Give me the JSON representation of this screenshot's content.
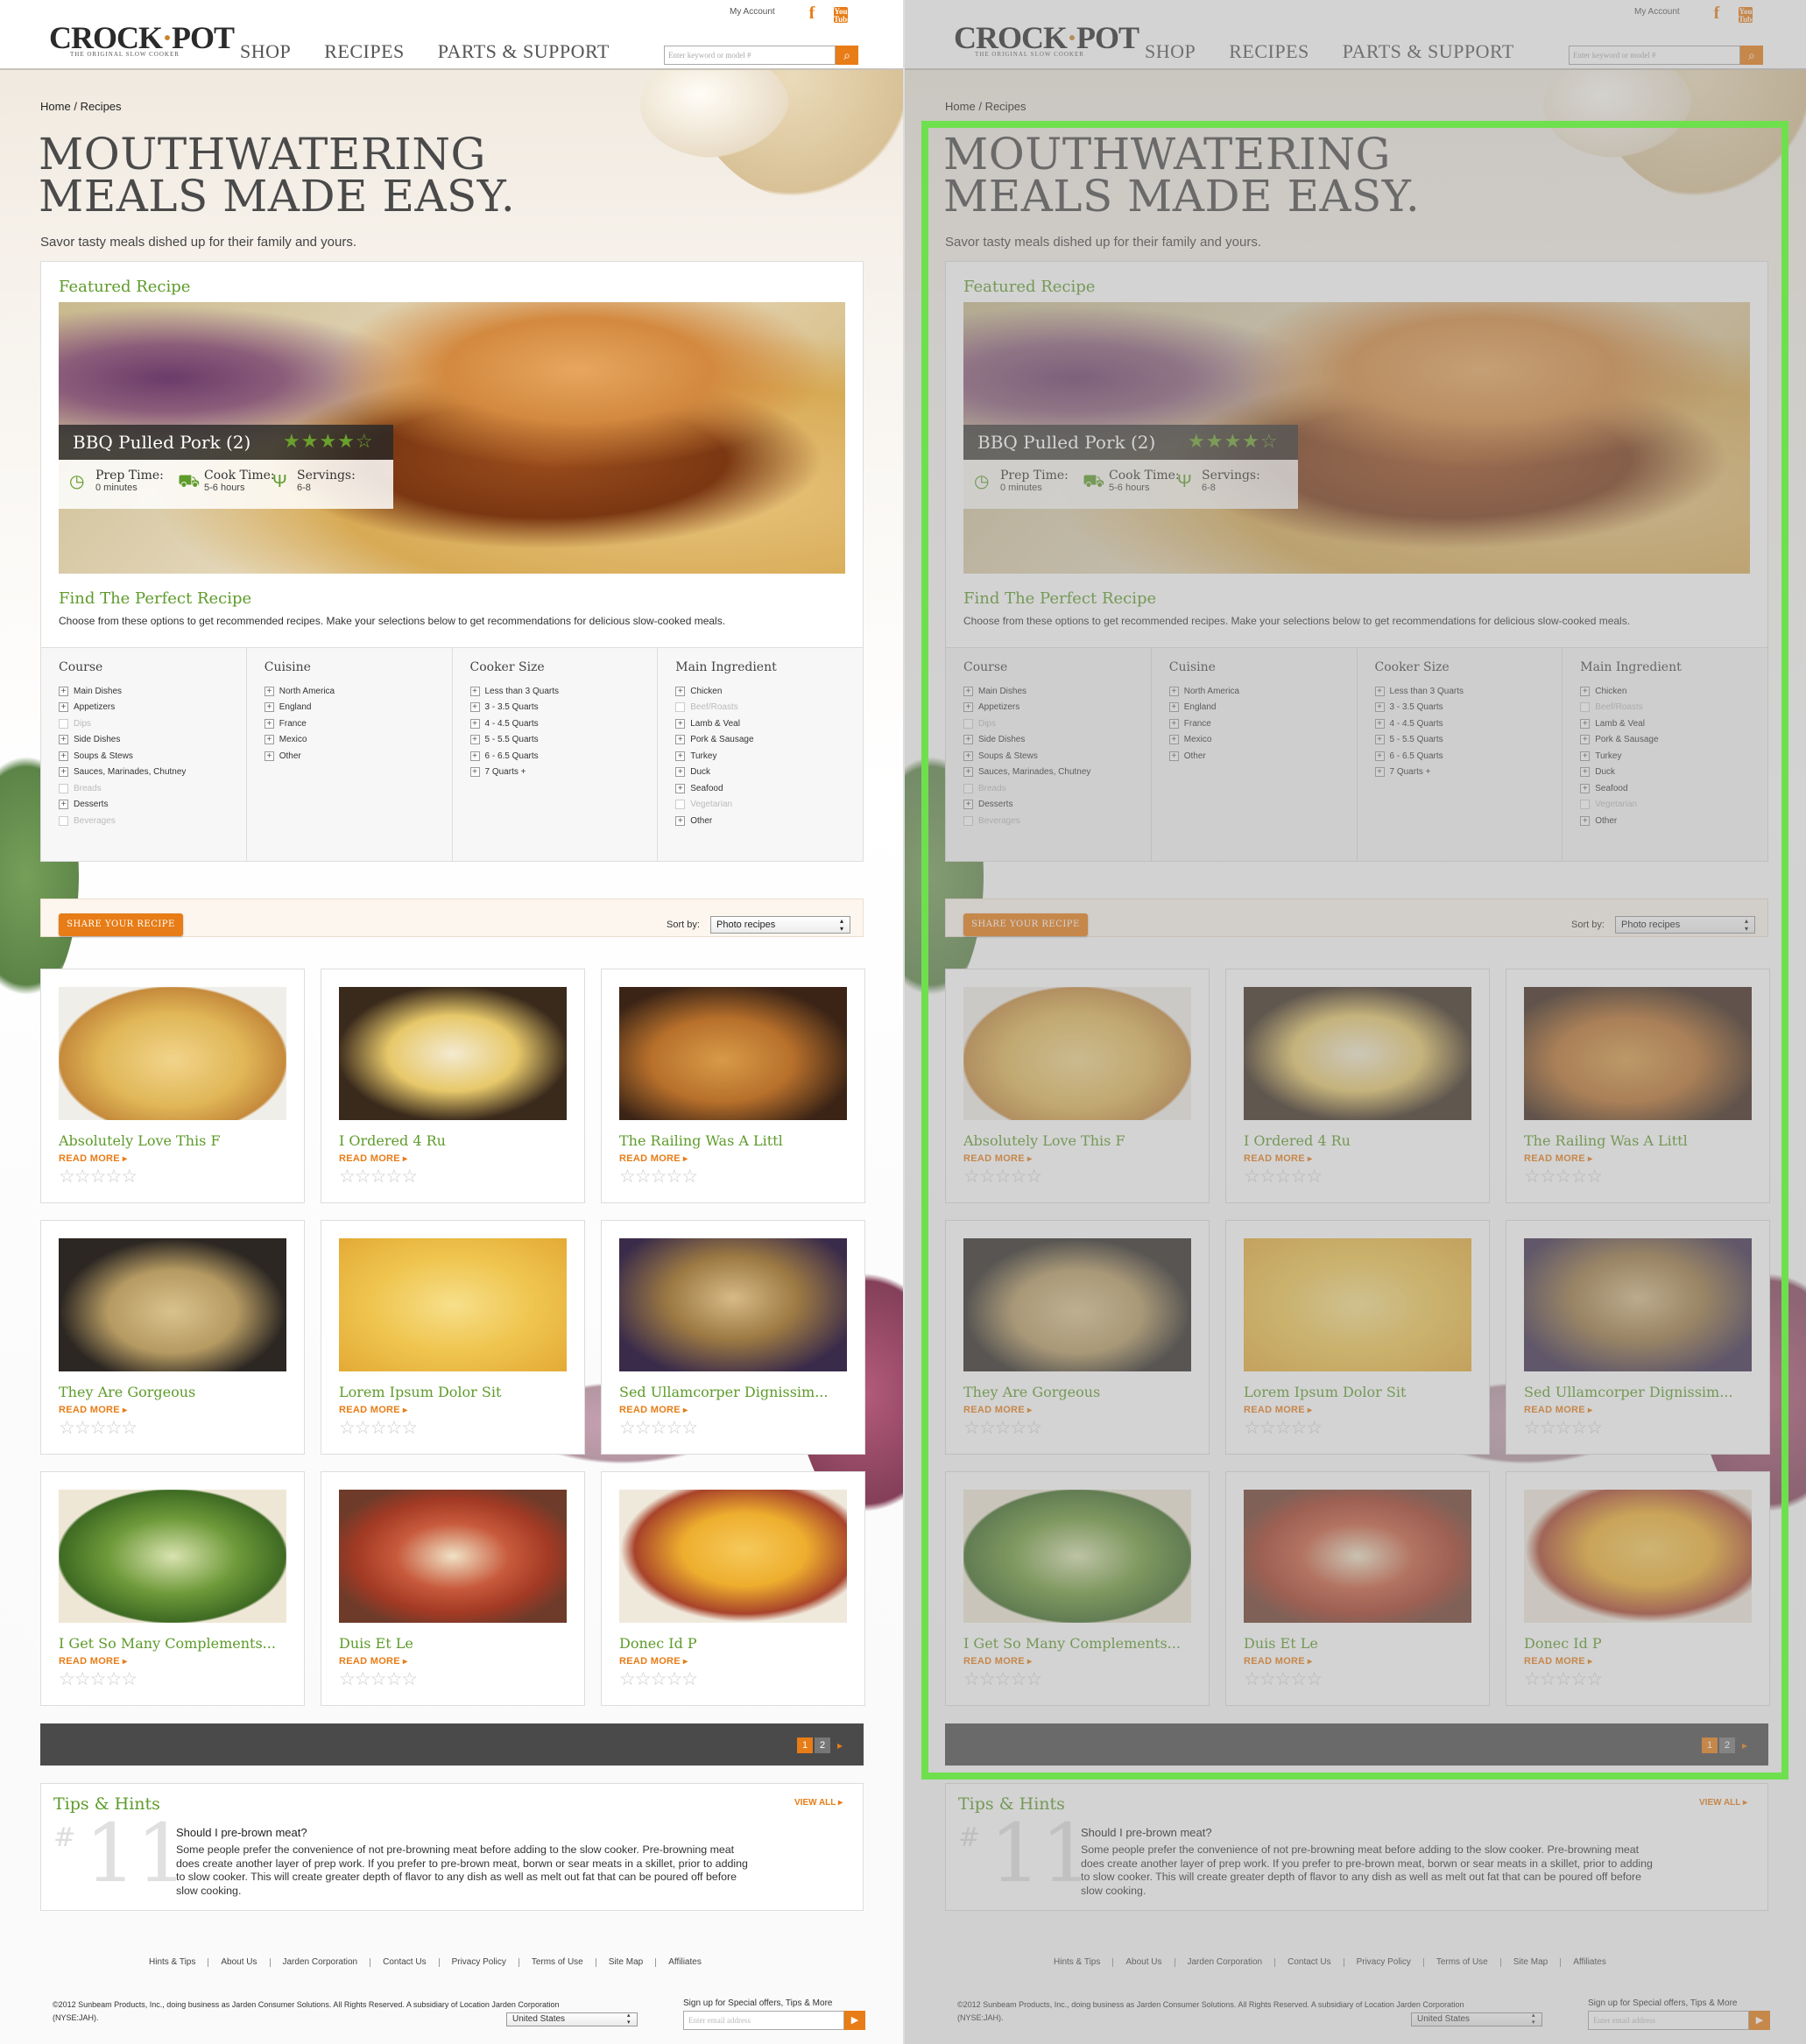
{
  "header": {
    "logo": "CROCK·POT",
    "logo_main": "CROCK",
    "logo_dot": "·",
    "logo_end": "POT",
    "logo_sub": "THE ORIGINAL SLOW COOKER",
    "my_account": "My Account",
    "facebook": "f",
    "youtube": "You Tube",
    "nav": [
      "SHOP",
      "RECIPES",
      "PARTS & SUPPORT"
    ],
    "search_placeholder": "Enter keyword or model #"
  },
  "breadcrumb": {
    "home": "Home",
    "sep": "/",
    "current": "Recipes"
  },
  "hero": {
    "line1": "MOUTHWATERING",
    "line2": "MEALS MADE EASY.",
    "subtitle": "Savor tasty meals dished up for their family and yours."
  },
  "featured": {
    "heading": "Featured Recipe",
    "name": "BBQ Pulled Pork (2)",
    "rating": 4,
    "rating_max": 5,
    "stars": "★★★★☆",
    "prep_label": "Prep Time:",
    "prep_value": "0 minutes",
    "cook_label": "Cook Time:",
    "cook_value": "5-6 hours",
    "serv_label": "Servings:",
    "serv_value": "6-8"
  },
  "finder": {
    "heading": "Find The Perfect Recipe",
    "description": "Choose from these options to get recommended recipes. Make your selections below to get recommendations for delicious slow-cooked meals.",
    "columns": [
      {
        "heading": "Course",
        "items": [
          {
            "label": "Main Dishes",
            "enabled": true
          },
          {
            "label": "Appetizers",
            "enabled": true
          },
          {
            "label": "Dips",
            "enabled": false
          },
          {
            "label": "Side Dishes",
            "enabled": true
          },
          {
            "label": "Soups & Stews",
            "enabled": true
          },
          {
            "label": "Sauces, Marinades, Chutney",
            "enabled": true
          },
          {
            "label": "Breads",
            "enabled": false
          },
          {
            "label": "Desserts",
            "enabled": true
          },
          {
            "label": "Beverages",
            "enabled": false
          }
        ]
      },
      {
        "heading": "Cuisine",
        "items": [
          {
            "label": "North America",
            "enabled": true
          },
          {
            "label": "England",
            "enabled": true
          },
          {
            "label": "France",
            "enabled": true
          },
          {
            "label": "Mexico",
            "enabled": true
          },
          {
            "label": "Other",
            "enabled": true
          }
        ]
      },
      {
        "heading": "Cooker Size",
        "items": [
          {
            "label": "Less than 3 Quarts",
            "enabled": true
          },
          {
            "label": "3 - 3.5 Quarts",
            "enabled": true
          },
          {
            "label": "4 - 4.5 Quarts",
            "enabled": true
          },
          {
            "label": "5 - 5.5 Quarts",
            "enabled": true
          },
          {
            "label": "6 - 6.5 Quarts",
            "enabled": true
          },
          {
            "label": "7 Quarts +",
            "enabled": true
          }
        ]
      },
      {
        "heading": "Main Ingredient",
        "items": [
          {
            "label": "Chicken",
            "enabled": true
          },
          {
            "label": "Beef/Roasts",
            "enabled": false
          },
          {
            "label": "Lamb & Veal",
            "enabled": true
          },
          {
            "label": "Pork & Sausage",
            "enabled": true
          },
          {
            "label": "Turkey",
            "enabled": true
          },
          {
            "label": "Duck",
            "enabled": true
          },
          {
            "label": "Seafood",
            "enabled": true
          },
          {
            "label": "Vegetarian",
            "enabled": false
          },
          {
            "label": "Other",
            "enabled": true
          }
        ]
      }
    ]
  },
  "toolbar": {
    "share_label": "SHARE YOUR RECIPE",
    "sort_label": "Sort by:",
    "sort_value": "Photo recipes"
  },
  "recipes": [
    {
      "title": "Absolutely Love This F",
      "read_more": "READ MORE",
      "rating": 0,
      "stars": "☆☆☆☆☆"
    },
    {
      "title": "I Ordered 4 Ru",
      "read_more": "READ MORE",
      "rating": 0,
      "stars": "☆☆☆☆☆"
    },
    {
      "title": "The Railing Was A Littl",
      "read_more": "READ MORE",
      "rating": 0,
      "stars": "☆☆☆☆☆"
    },
    {
      "title": "They Are Gorgeous",
      "read_more": "READ MORE",
      "rating": 0,
      "stars": "☆☆☆☆☆"
    },
    {
      "title": "Lorem Ipsum Dolor Sit",
      "read_more": "READ MORE",
      "rating": 0,
      "stars": "☆☆☆☆☆"
    },
    {
      "title": "Sed Ullamcorper Dignissim...",
      "read_more": "READ MORE",
      "rating": 0,
      "stars": "☆☆☆☆☆"
    },
    {
      "title": "I Get So Many Complements...",
      "read_more": "READ MORE",
      "rating": 0,
      "stars": "☆☆☆☆☆"
    },
    {
      "title": "Duis Et Le",
      "read_more": "READ MORE",
      "rating": 0,
      "stars": "☆☆☆☆☆"
    },
    {
      "title": "Donec Id P",
      "read_more": "READ MORE",
      "rating": 0,
      "stars": "☆☆☆☆☆"
    }
  ],
  "pagination": {
    "pages": [
      "1",
      "2"
    ],
    "current": "1",
    "next": "▸"
  },
  "tips": {
    "heading": "Tips & Hints",
    "view_all": "VIEW ALL",
    "hash": "#",
    "number": "11",
    "question": "Should I pre-brown meat?",
    "answer": "Some people prefer the convenience of not pre-browning meat before adding to the slow cooker. Pre-browning meat does create another layer of prep work. If you prefer to pre-brown meat, borwn or sear meats in a skillet, prior to adding to slow cooker. This will create greater depth of flavor to any dish as well as melt out fat that can be poured off before slow cooking."
  },
  "footer": {
    "links": [
      "Hints & Tips",
      "About Us",
      "Jarden Corporation",
      "Contact Us",
      "Privacy Policy",
      "Terms of Use",
      "Site Map",
      "Affiliates"
    ],
    "copyright": "©2012 Sunbeam Products, Inc., doing business as Jarden Consumer Solutions. All Rights Reserved. A subsidiary of Location Jarden Corporation (NYSE:JAH).",
    "country": "United States",
    "signup_label": "Sign up for Special offers, Tips & More",
    "email_placeholder": "Enter email address"
  },
  "colors": {
    "accent": "#e87c16",
    "green": "#5d9b2a",
    "highlight": "#6ee04e",
    "pager_bg": "#4a4a4a"
  },
  "icons": [
    "search-icon",
    "facebook-icon",
    "youtube-icon",
    "clock-icon",
    "cooker-icon",
    "utensils-icon",
    "star-icon",
    "chevron-right-icon",
    "select-arrows-icon",
    "plus-icon"
  ]
}
